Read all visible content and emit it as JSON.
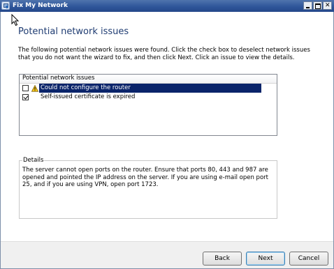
{
  "window": {
    "title": "Fix My Network",
    "icon": "network-fix-icon",
    "controls": [
      "minimize-icon",
      "maximize-icon",
      "close-icon"
    ]
  },
  "page": {
    "heading": "Potential network issues",
    "intro": "The following potential network issues were found. Click the check box to deselect network issues that you do not want the wizard to fix, and then click Next. Click an issue to view the details."
  },
  "issues": {
    "column_header": "Potential network issues",
    "items": [
      {
        "label": "Could not configure the router",
        "checked": false,
        "icon": "warning-icon",
        "selected": true
      },
      {
        "label": "Self-issued certificate is expired",
        "checked": true,
        "icon": "",
        "selected": false
      }
    ]
  },
  "details": {
    "legend": "Details",
    "text": "The server cannot open ports on the router. Ensure that ports 80, 443 and 987 are opened and pointed the IP address on the server. If you are using e-mail open port 25, and if you are using VPN, open port 1723."
  },
  "buttons": {
    "back": "Back",
    "next": "Next",
    "cancel": "Cancel"
  },
  "colors": {
    "heading": "#1f3c72",
    "selection": "#0a246a",
    "titlebar": "#2f569a"
  }
}
